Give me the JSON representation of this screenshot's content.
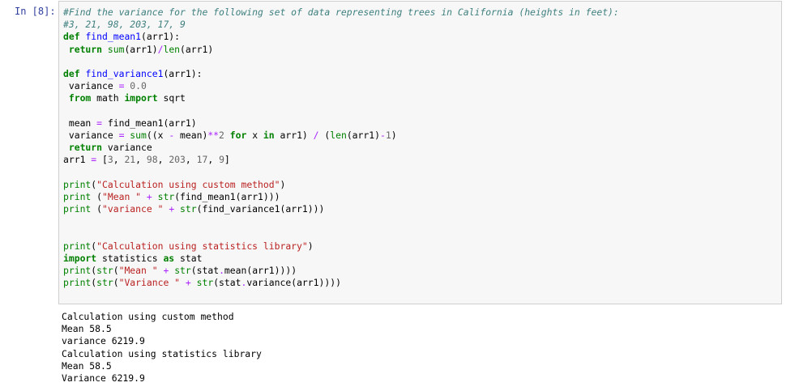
{
  "prompt": "In [8]:",
  "code": [
    [
      [
        "c",
        "#Find the variance for the following set of data representing trees in California (heights in feet):"
      ]
    ],
    [
      [
        "c",
        "#3, 21, 98, 203, 17, 9"
      ]
    ],
    [
      [
        "k",
        "def"
      ],
      [
        "p",
        " "
      ],
      [
        "f",
        "find_mean1"
      ],
      [
        "p",
        "(arr1):"
      ]
    ],
    [
      [
        "p",
        " "
      ],
      [
        "k",
        "return"
      ],
      [
        "p",
        " "
      ],
      [
        "n",
        "sum"
      ],
      [
        "p",
        "(arr1)"
      ],
      [
        "o",
        "/"
      ],
      [
        "n",
        "len"
      ],
      [
        "p",
        "(arr1)"
      ]
    ],
    [],
    [
      [
        "k",
        "def"
      ],
      [
        "p",
        " "
      ],
      [
        "f",
        "find_variance1"
      ],
      [
        "p",
        "(arr1):"
      ]
    ],
    [
      [
        "p",
        " variance "
      ],
      [
        "o",
        "="
      ],
      [
        "p",
        " "
      ],
      [
        "m",
        "0.0"
      ]
    ],
    [
      [
        "p",
        " "
      ],
      [
        "k",
        "from"
      ],
      [
        "p",
        " math "
      ],
      [
        "k",
        "import"
      ],
      [
        "p",
        " sqrt"
      ]
    ],
    [],
    [
      [
        "p",
        " mean "
      ],
      [
        "o",
        "="
      ],
      [
        "p",
        " find_mean1(arr1)"
      ]
    ],
    [
      [
        "p",
        " variance "
      ],
      [
        "o",
        "="
      ],
      [
        "p",
        " "
      ],
      [
        "n",
        "sum"
      ],
      [
        "p",
        "((x "
      ],
      [
        "o",
        "-"
      ],
      [
        "p",
        " mean)"
      ],
      [
        "o",
        "**"
      ],
      [
        "m",
        "2"
      ],
      [
        "p",
        " "
      ],
      [
        "k",
        "for"
      ],
      [
        "p",
        " x "
      ],
      [
        "k",
        "in"
      ],
      [
        "p",
        " arr1) "
      ],
      [
        "o",
        "/"
      ],
      [
        "p",
        " ("
      ],
      [
        "n",
        "len"
      ],
      [
        "p",
        "(arr1)"
      ],
      [
        "o",
        "-"
      ],
      [
        "m",
        "1"
      ],
      [
        "p",
        ")"
      ]
    ],
    [
      [
        "p",
        " "
      ],
      [
        "k",
        "return"
      ],
      [
        "p",
        " variance"
      ]
    ],
    [
      [
        "p",
        "arr1 "
      ],
      [
        "o",
        "="
      ],
      [
        "p",
        " ["
      ],
      [
        "m",
        "3"
      ],
      [
        "p",
        ", "
      ],
      [
        "m",
        "21"
      ],
      [
        "p",
        ", "
      ],
      [
        "m",
        "98"
      ],
      [
        "p",
        ", "
      ],
      [
        "m",
        "203"
      ],
      [
        "p",
        ", "
      ],
      [
        "m",
        "17"
      ],
      [
        "p",
        ", "
      ],
      [
        "m",
        "9"
      ],
      [
        "p",
        "]"
      ]
    ],
    [],
    [
      [
        "n",
        "print"
      ],
      [
        "p",
        "("
      ],
      [
        "s",
        "\"Calculation using custom method\""
      ],
      [
        "p",
        ")"
      ]
    ],
    [
      [
        "n",
        "print"
      ],
      [
        "p",
        " ("
      ],
      [
        "s",
        "\"Mean \""
      ],
      [
        "p",
        " "
      ],
      [
        "o",
        "+"
      ],
      [
        "p",
        " "
      ],
      [
        "n",
        "str"
      ],
      [
        "p",
        "(find_mean1(arr1)))"
      ]
    ],
    [
      [
        "n",
        "print"
      ],
      [
        "p",
        " ("
      ],
      [
        "s",
        "\"variance \""
      ],
      [
        "p",
        " "
      ],
      [
        "o",
        "+"
      ],
      [
        "p",
        " "
      ],
      [
        "n",
        "str"
      ],
      [
        "p",
        "(find_variance1(arr1)))"
      ]
    ],
    [],
    [],
    [
      [
        "n",
        "print"
      ],
      [
        "p",
        "("
      ],
      [
        "s",
        "\"Calculation using statistics library\""
      ],
      [
        "p",
        ")"
      ]
    ],
    [
      [
        "k",
        "import"
      ],
      [
        "p",
        " statistics "
      ],
      [
        "k",
        "as"
      ],
      [
        "p",
        " stat"
      ]
    ],
    [
      [
        "n",
        "print"
      ],
      [
        "p",
        "("
      ],
      [
        "n",
        "str"
      ],
      [
        "p",
        "("
      ],
      [
        "s",
        "\"Mean \""
      ],
      [
        "p",
        " "
      ],
      [
        "o",
        "+"
      ],
      [
        "p",
        " "
      ],
      [
        "n",
        "str"
      ],
      [
        "p",
        "(stat"
      ],
      [
        "o",
        "."
      ],
      [
        "p",
        "mean(arr1))))"
      ]
    ],
    [
      [
        "n",
        "print"
      ],
      [
        "p",
        "("
      ],
      [
        "n",
        "str"
      ],
      [
        "p",
        "("
      ],
      [
        "s",
        "\"Variance \""
      ],
      [
        "p",
        " "
      ],
      [
        "o",
        "+"
      ],
      [
        "p",
        " "
      ],
      [
        "n",
        "str"
      ],
      [
        "p",
        "(stat"
      ],
      [
        "o",
        "."
      ],
      [
        "p",
        "variance(arr1))))"
      ]
    ]
  ],
  "output": [
    "Calculation using custom method",
    "Mean 58.5",
    "variance 6219.9",
    "Calculation using statistics library",
    "Mean 58.5",
    "Variance 6219.9"
  ]
}
